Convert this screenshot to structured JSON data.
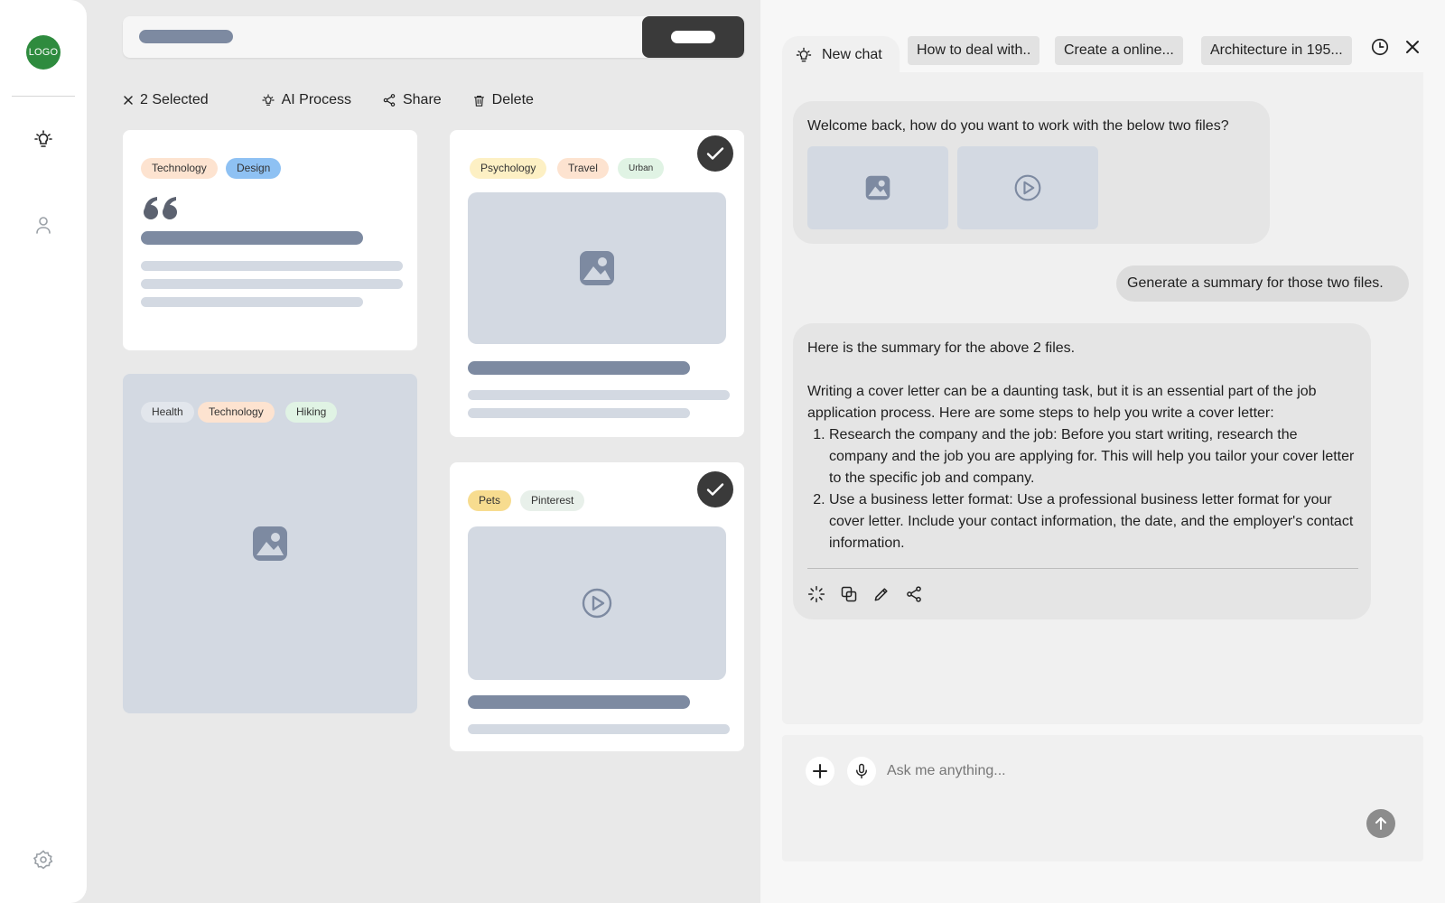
{
  "sidebar": {
    "logo": "LOGO",
    "icons": [
      "bulb-icon",
      "user-icon",
      "settings-icon"
    ]
  },
  "actions": {
    "selected": "2 Selected",
    "ai_process": "AI Process",
    "share": "Share",
    "delete": "Delete"
  },
  "cards": [
    {
      "tags": [
        "Technology",
        "Design"
      ],
      "type": "quote",
      "selected": false
    },
    {
      "tags": [
        "Health",
        "Technology",
        "Hiking"
      ],
      "type": "image",
      "selected": false
    },
    {
      "tags": [
        "Psychology",
        "Travel",
        "Urban"
      ],
      "type": "image",
      "selected": true
    },
    {
      "tags": [
        "Pets",
        "Pinterest"
      ],
      "type": "video",
      "selected": true
    }
  ],
  "colors": {
    "tag_orange": "#fde3d0",
    "tag_blue": "#8ec1f3",
    "tag_yellow": "#fdf0c4",
    "tag_gold": "#f7dc8f",
    "tag_green": "#e0f3e4",
    "tag_light": "#e8f0ea",
    "logo": "#2e8b3e",
    "dark": "#3a3a3a",
    "placeholder": "#d3d9e2",
    "skeleton": "#7d8aa1"
  },
  "chat": {
    "tabs": {
      "active": "New chat",
      "t1": "How to deal with..",
      "t2": "Create a online...",
      "t3": "Architecture in 195..."
    },
    "welcome": "Welcome back, how do you want to work with the below two files?",
    "user_msg": "Generate a summary for those two files.",
    "ai": {
      "intro": "Here is the summary for the above 2 files.",
      "para": "Writing a cover letter can be a daunting task, but it is an essential part of the job application process. Here are some steps to help you write a cover letter:",
      "steps": [
        "Research the company and the job: Before you start writing, research the company and the job you are applying for. This will help you tailor your cover letter to the specific job and company.",
        "Use a business letter format: Use a professional business letter format for your cover letter. Include your contact information, the date, and the employer's contact information."
      ]
    },
    "composer_placeholder": "Ask me anything..."
  }
}
